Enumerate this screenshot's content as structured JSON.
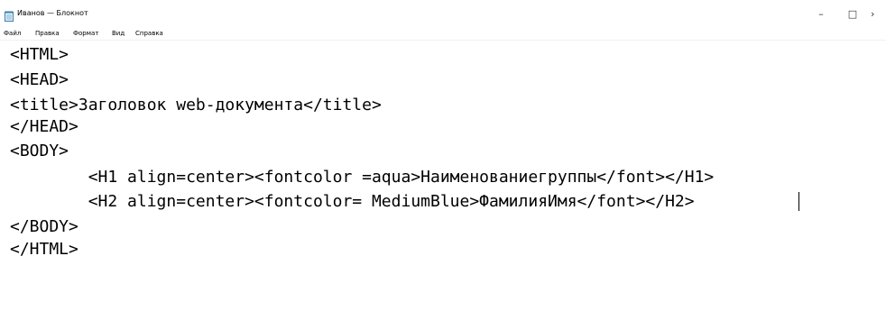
{
  "window": {
    "title": "Иванов — Блокнот",
    "controls": {
      "minimize": "–",
      "maximize": "□",
      "close": "›"
    }
  },
  "menu": {
    "items": [
      "Файл",
      "Правка",
      "Формат",
      "Вид",
      "Справка"
    ]
  },
  "editor": {
    "lines": [
      "<HTML>",
      "<HEAD>",
      "<title>Заголовок web-документа</title>",
      "</HEAD>",
      "<BODY>",
      "        <H1 align=center><fontcolor =aqua>Наименованиегруппы</font></H1>",
      "        <H2 align=center><fontcolor= MediumBlue>ФамилияИмя</font></H2>",
      "</BODY>",
      "</HTML>"
    ]
  }
}
